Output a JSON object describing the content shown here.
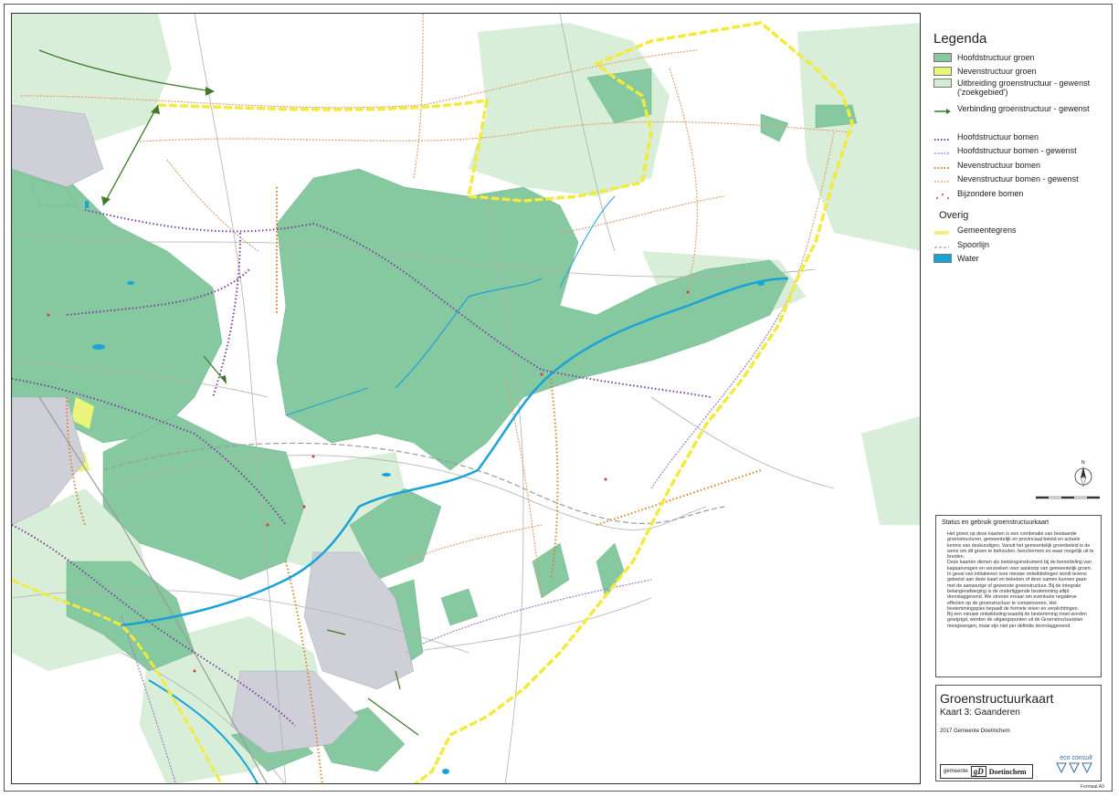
{
  "legend": {
    "title": "Legenda",
    "items": [
      {
        "label": "Hoofdstructuur groen",
        "kind": "fill",
        "color": "#86c8a0"
      },
      {
        "label": "Nevenstructuur groen",
        "kind": "fill",
        "color": "#e8f57a"
      },
      {
        "label": "Uitbreiding groenstructuur - gewenst ('zoekgebied')",
        "kind": "fill",
        "color": "#d4ecd4"
      },
      {
        "label": "Verbinding groenstructuur - gewenst",
        "kind": "arrow",
        "color": "#3c7a2a"
      },
      {
        "label": "Hoofdstructuur bomen",
        "kind": "dots",
        "color": "#7a3fa0"
      },
      {
        "label": "Hoofdstructuur bomen - gewenst",
        "kind": "dotline",
        "color": "#a07ac8"
      },
      {
        "label": "Nevenstructuur bomen",
        "kind": "dots",
        "color": "#d9822b"
      },
      {
        "label": "Nevenstructuur bomen - gewenst",
        "kind": "dotline",
        "color": "#e0a070"
      },
      {
        "label": "Bijzondere bomen",
        "kind": "points",
        "color": "#d43a3a"
      }
    ],
    "overig_title": "Overig",
    "overig_items": [
      {
        "label": "Gemeentegrens",
        "kind": "boundary",
        "color": "#f0ef80"
      },
      {
        "label": "Spoorlijn",
        "kind": "rail",
        "color": "#888888"
      },
      {
        "label": "Water",
        "kind": "fill",
        "color": "#1aa3d8"
      }
    ]
  },
  "status": {
    "title": "Status en gebruik groenstructuurkaart",
    "paragraphs": [
      "Het groen op deze kaarten is een combinatie van bestaande groenstructuren, gemeentelijk en provinciaal beleid en actuele kennis van deskundigen. Vanuit het gemeentelijk groenbeleid is de wens om dit groen te behouden, beschermen en waar mogelijk uit te breiden.",
      "Deze kaarten dienen als toetsingsinstrument bij de beoordeling van kapaanvragen en verzoeken voor aankoop van gemeentelijk groen.",
      "In geval van initiatieven voor nieuwe ontwikkelingen wordt tevens getoetst aan deze kaart en bekeken of deze samen kunnen gaan met de aanwezige of gewenste groenstructuur. Bij de integrale belangenafweging is de onderliggende bestemming altijd doorslaggevend. We streven ernaar om eventuele negatieve effecten op de groenstructuur te compenseren. Het bestemmingsplan bepaalt de formele eisen en verplichtingen.",
      "Bij een nieuwe ontwikkeling waarbij de bestemming moet worden gewijzigd, worden de uitgangspunten uit de Groenstructuurplan meegewogen, maar zijn niet per definitie doorslaggevend."
    ]
  },
  "titleblock": {
    "title": "Groenstructuurkaart",
    "subtitle": "Kaart 3: Gaanderen",
    "year": "2017 Gemeente Doetinchem"
  },
  "logos": {
    "gemeente_prefix": "gemeente",
    "gemeente_mark": "gD",
    "gemeente_name": "Doetinchem",
    "eco": "eco consult"
  },
  "compass": {
    "label": "N"
  },
  "format_label": "Formaat A0",
  "colors": {
    "hoofd_groen": "#86c8a0",
    "uitbreiding": "#d4ecd4",
    "neven_groen": "#e8f57a",
    "water": "#1aa3d8",
    "boundary": "#f2ea3c",
    "purple": "#7a3fa0",
    "orange": "#d9822b",
    "arrow": "#3c7a2a"
  }
}
